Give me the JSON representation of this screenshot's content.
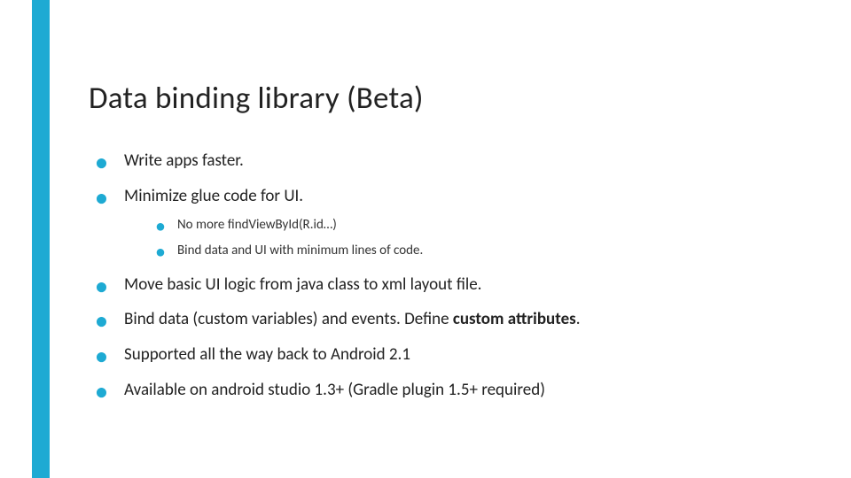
{
  "title": "Data binding library (Beta)",
  "bullets": {
    "b0": "Write apps faster.",
    "b1": "Minimize glue code for UI.",
    "b1_sub": {
      "s0": "No more findViewById(R.id…)",
      "s1": "Bind data and UI with minimum lines of code."
    },
    "b2": "Move basic UI logic from java class to xml layout file.",
    "b3_pre": "Bind data (custom variables) and events. Define ",
    "b3_bold": "custom attributes",
    "b3_post": ".",
    "b4": "Supported all the way back to Android 2.1",
    "b5": "Available on android studio 1.3+ (Gradle plugin 1.5+ required)"
  }
}
